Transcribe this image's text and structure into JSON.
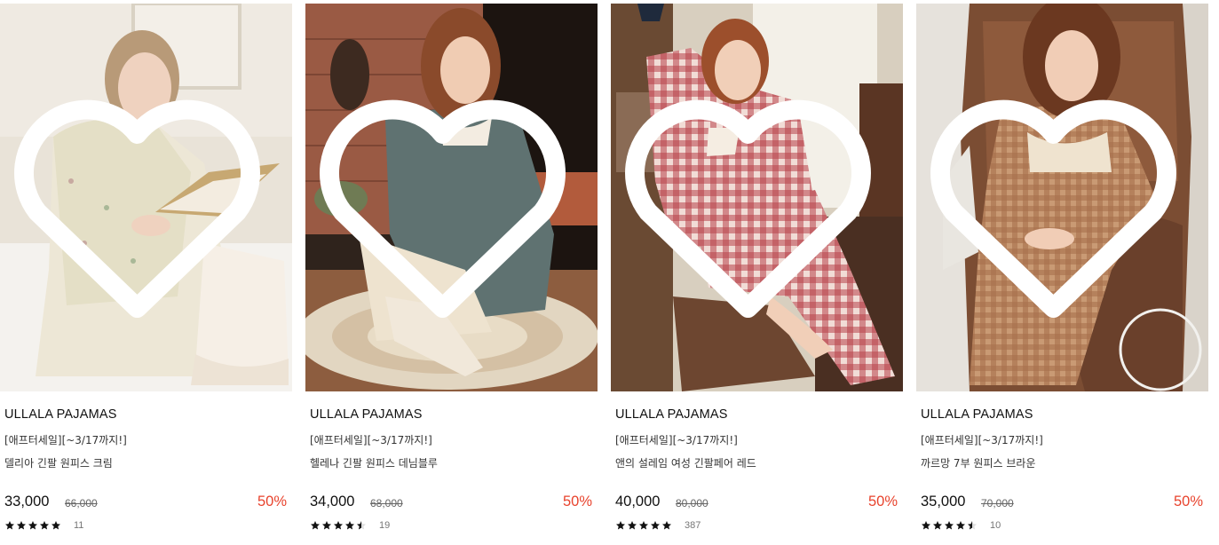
{
  "products": [
    {
      "brand": "ULLALA PAJAMAS",
      "promo": "[애프터세일][~3/17까지!]",
      "name": "델리아 긴팔 원피스 크림",
      "price": "33,000",
      "original_price": "66,000",
      "discount": "50%",
      "rating": 5,
      "review_count": "11",
      "photo": "woman in cream floral long-sleeve nightgown reading a book on a bed"
    },
    {
      "brand": "ULLALA PAJAMAS",
      "promo": "[애프터세일][~3/17까지!]",
      "name": "헬레나 긴팔 원피스 데님블루",
      "price": "34,000",
      "original_price": "68,000",
      "discount": "50%",
      "rating": 4.5,
      "review_count": "19",
      "photo": "woman in denim-blue ruffled nightgown sitting on a round rug by a brick fireplace"
    },
    {
      "brand": "ULLALA PAJAMAS",
      "promo": "[애프터세일][~3/17까지!]",
      "name": "앤의 설레임 여성 긴팔페어 레드",
      "price": "40,000",
      "original_price": "80,000",
      "discount": "50%",
      "rating": 5,
      "review_count": "387",
      "photo": "woman in red gingham pajama set sitting on a wooden chair by a window"
    },
    {
      "brand": "ULLALA PAJAMAS",
      "promo": "[애프터세일][~3/17까지!]",
      "name": "까르망 7부 원피스 브라운",
      "price": "35,000",
      "original_price": "70,000",
      "discount": "50%",
      "rating": 4.5,
      "review_count": "10",
      "photo": "woman in brown check nightgown with lace collar sitting in a leather armchair"
    }
  ],
  "colors": {
    "discount": "#e8432d",
    "star": "#111111",
    "text": "#111111"
  },
  "icons": {
    "wishlist": "heart-outline-icon",
    "rating": "star-icon"
  }
}
